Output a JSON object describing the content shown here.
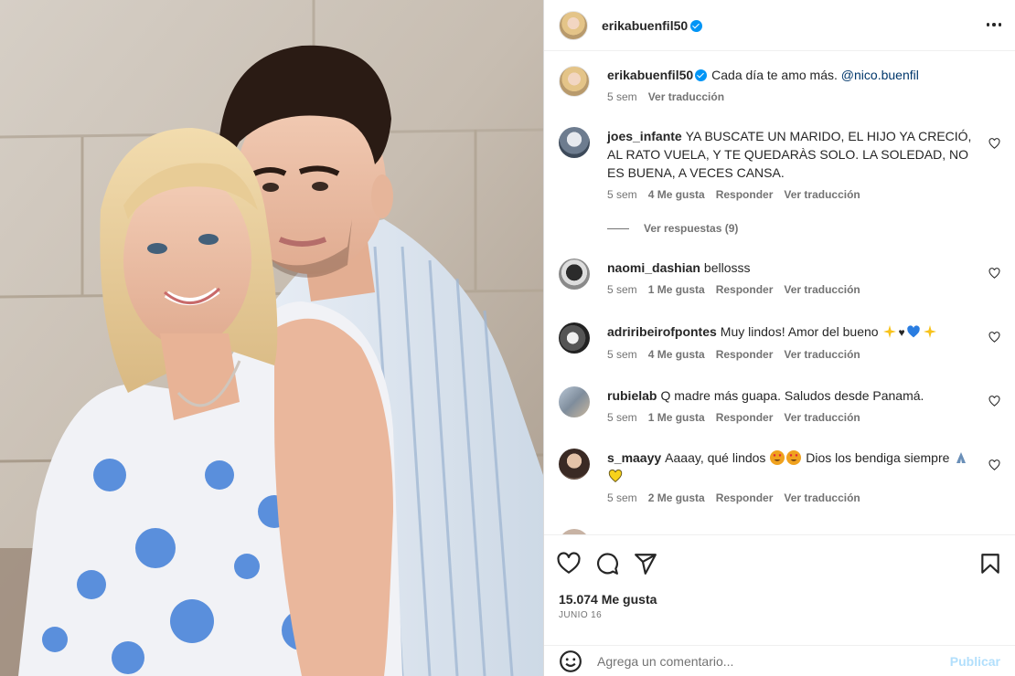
{
  "post": {
    "author": "erikabuenfil50",
    "verified": true,
    "more_icon": "more-horizontal-icon"
  },
  "caption": {
    "username": "erikabuenfil50",
    "text": "Cada día te amo más.",
    "mention": "@nico.buenfil",
    "time": "5 sem",
    "translate": "Ver traducción"
  },
  "comments": [
    {
      "username": "joes_infante",
      "text": "YA BUSCATE UN MARIDO, EL HIJO YA CRECIÓ, AL RATO VUELA, Y TE QUEDARÀS SOLO. LA SOLEDAD, NO ES BUENA, A VECES CANSA.",
      "time": "5 sem",
      "likes": "4 Me gusta",
      "reply": "Responder",
      "translate": "Ver traducción",
      "replies": "Ver respuestas (9)"
    },
    {
      "username": "naomi_dashian",
      "text": "bellosss",
      "time": "5 sem",
      "likes": "1 Me gusta",
      "reply": "Responder",
      "translate": "Ver traducción"
    },
    {
      "username": "adriribeirofpontes",
      "text": "Muy lindos! Amor del bueno",
      "emojis": [
        "sparkles",
        "black-heart",
        "blue-heart",
        "sparkles"
      ],
      "time": "5 sem",
      "likes": "4 Me gusta",
      "reply": "Responder",
      "translate": "Ver traducción"
    },
    {
      "username": "rubielab",
      "text": "Q madre más guapa. Saludos desde Panamá.",
      "time": "5 sem",
      "likes": "1 Me gusta",
      "reply": "Responder",
      "translate": "Ver traducción"
    },
    {
      "username": "s_maayy",
      "text_before": "Aaaay, qué lindos",
      "text_after": "Dios los bendiga siempre",
      "emojis": [
        "heart-eyes",
        "heart-eyes",
        "folded-hands",
        "yellow-heart"
      ],
      "time": "5 sem",
      "likes": "2 Me gusta",
      "reply": "Responder",
      "translate": "Ver traducción"
    }
  ],
  "actions": {
    "icons": [
      "heart-icon",
      "comment-icon",
      "share-icon",
      "bookmark-icon"
    ],
    "likes": "15.074 Me gusta",
    "date": "JUNIO 16"
  },
  "add_comment": {
    "placeholder": "Agrega un comentario...",
    "publish": "Publicar"
  },
  "colors": {
    "verified": "#0095f6",
    "mention": "#00376b",
    "secondary_text": "#737373",
    "publish_disabled": "#b2dffc"
  }
}
